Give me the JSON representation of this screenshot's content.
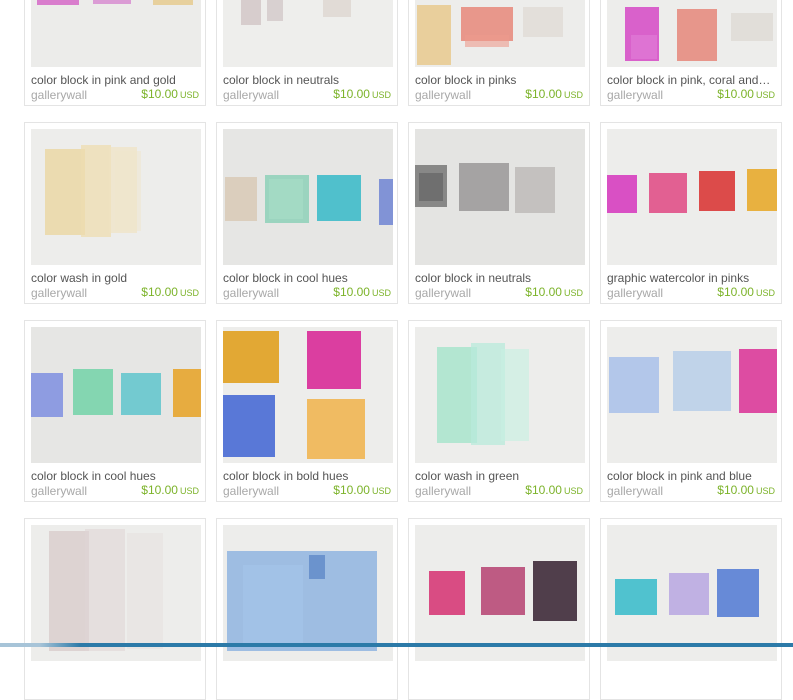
{
  "listings": [
    {
      "title": "color block in pink and gold",
      "shop": "gallerywall",
      "price": "$10.00",
      "currency": "USD",
      "image": "pink-gold-swatches"
    },
    {
      "title": "color block in neutrals",
      "shop": "gallerywall",
      "price": "$10.00",
      "currency": "USD",
      "image": "neutral-swatches"
    },
    {
      "title": "color block in pinks",
      "shop": "gallerywall",
      "price": "$10.00",
      "currency": "USD",
      "image": "pink-swatches"
    },
    {
      "title": "color block in pink, coral and…",
      "shop": "gallerywall",
      "price": "$10.00",
      "currency": "USD",
      "image": "pink-coral-swatches"
    },
    {
      "title": "color wash in gold",
      "shop": "gallerywall",
      "price": "$10.00",
      "currency": "USD",
      "image": "gold-wash"
    },
    {
      "title": "color block in cool hues",
      "shop": "gallerywall",
      "price": "$10.00",
      "currency": "USD",
      "image": "cool-hue-swatches"
    },
    {
      "title": "color block in neutrals",
      "shop": "gallerywall",
      "price": "$10.00",
      "currency": "USD",
      "image": "gray-swatches"
    },
    {
      "title": "graphic watercolor in pinks",
      "shop": "gallerywall",
      "price": "$10.00",
      "currency": "USD",
      "image": "pink-red-gold-swatches"
    },
    {
      "title": "color block in cool hues",
      "shop": "gallerywall",
      "price": "$10.00",
      "currency": "USD",
      "image": "cool-hue-swatches-2"
    },
    {
      "title": "color block in bold hues",
      "shop": "gallerywall",
      "price": "$10.00",
      "currency": "USD",
      "image": "bold-hue-swatches"
    },
    {
      "title": "color wash in green",
      "shop": "gallerywall",
      "price": "$10.00",
      "currency": "USD",
      "image": "green-wash"
    },
    {
      "title": "color block in pink and blue",
      "shop": "gallerywall",
      "price": "$10.00",
      "currency": "USD",
      "image": "pink-blue-swatches"
    },
    {
      "image": "mauve-wash"
    },
    {
      "image": "blue-wash"
    },
    {
      "image": "berry-plum-swatches"
    },
    {
      "image": "teal-lilac-blue-swatches"
    }
  ]
}
